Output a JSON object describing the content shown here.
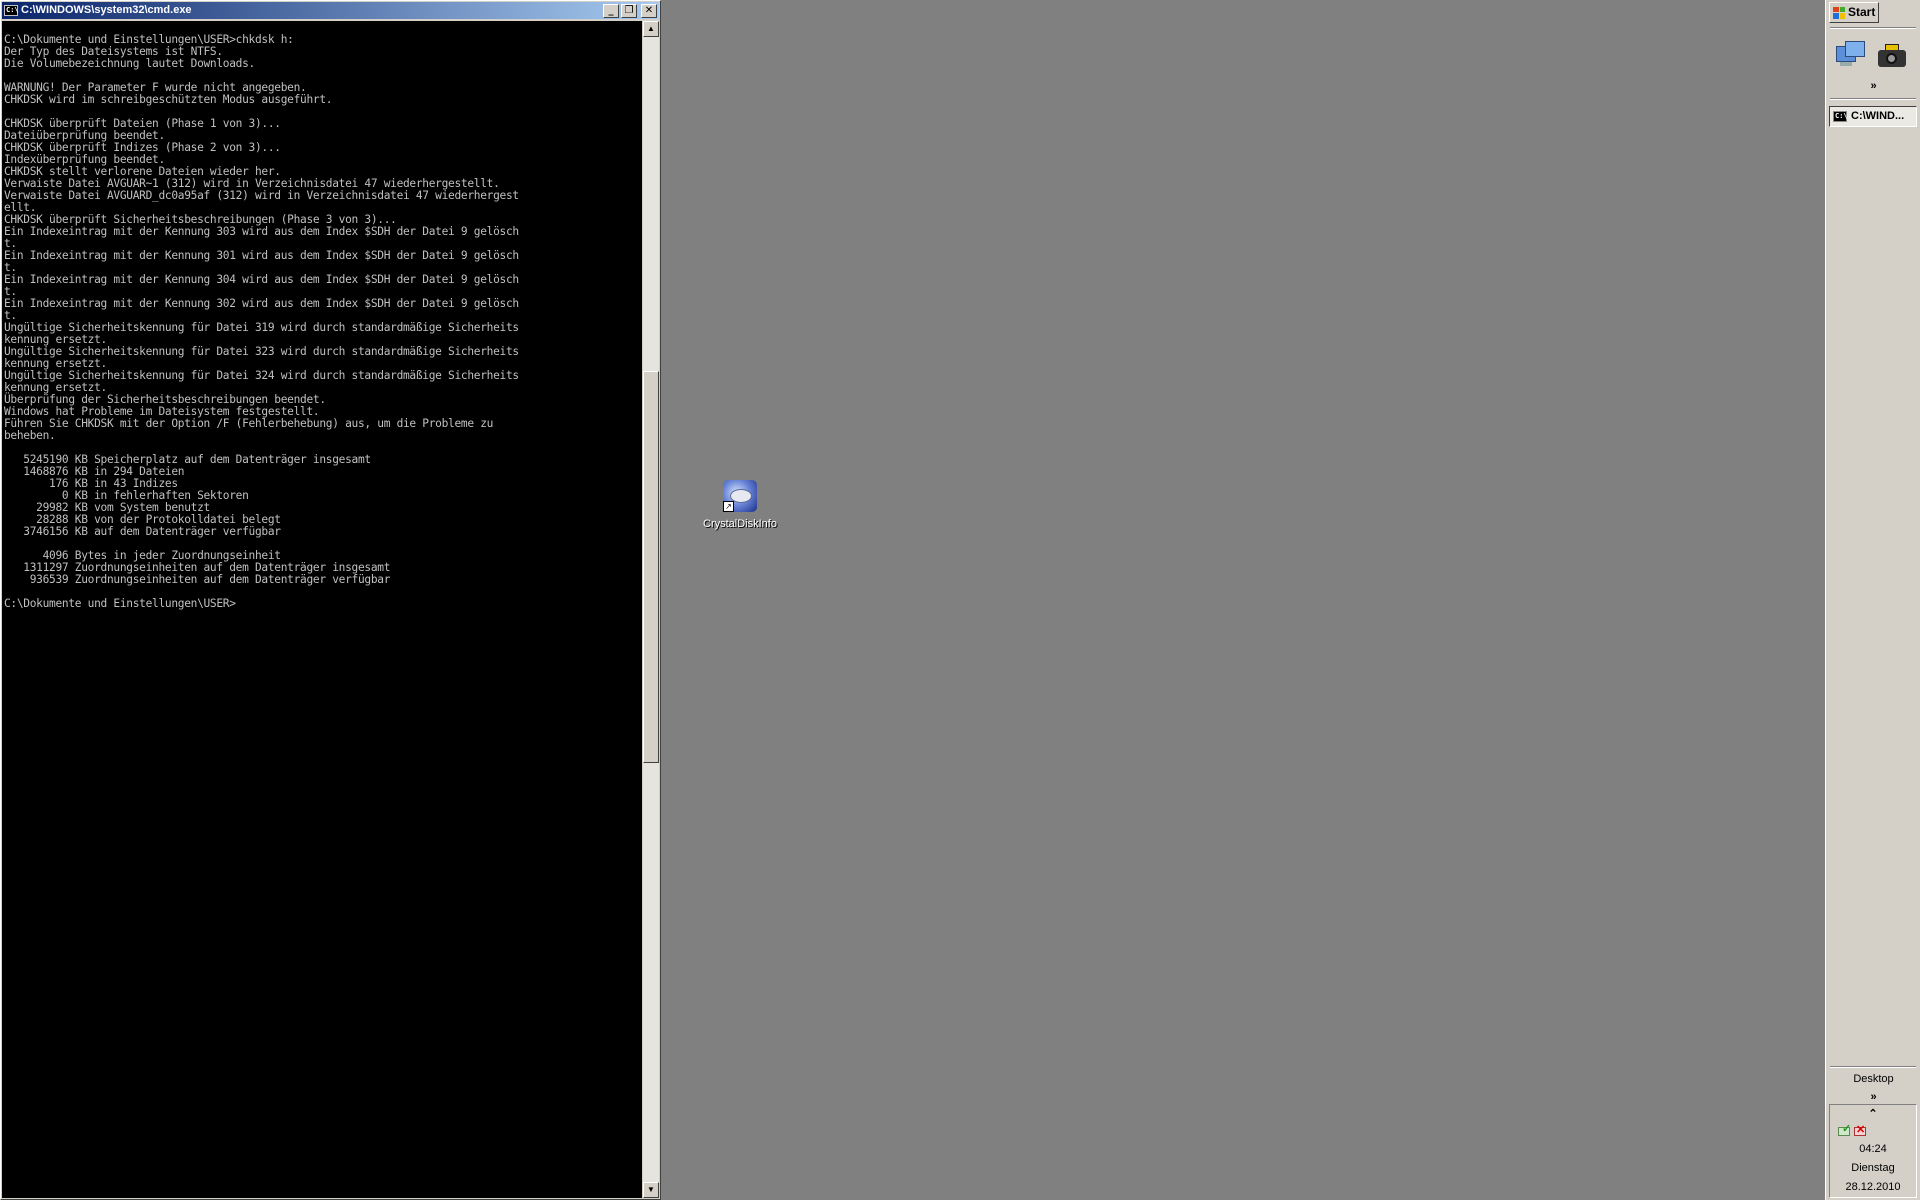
{
  "console_window": {
    "title": "C:\\WINDOWS\\system32\\cmd.exe",
    "app_icon_text": "C:\\",
    "buttons": {
      "minimize": "_",
      "restore": "❐",
      "close": "✕"
    },
    "output": "C:\\Dokumente und Einstellungen\\USER>chkdsk h:\nDer Typ des Dateisystems ist NTFS.\nDie Volumebezeichnung lautet Downloads.\n\nWARNUNG! Der Parameter F wurde nicht angegeben.\nCHKDSK wird im schreibgeschützten Modus ausgeführt.\n\nCHKDSK überprüft Dateien (Phase 1 von 3)...\nDateiüberprüfung beendet.\nCHKDSK überprüft Indizes (Phase 2 von 3)...\nIndexüberprüfung beendet.\nCHKDSK stellt verlorene Dateien wieder her.\nVerwaiste Datei AVGUAR~1 (312) wird in Verzeichnisdatei 47 wiederhergestellt.\nVerwaiste Datei AVGUARD_dc0a95af (312) wird in Verzeichnisdatei 47 wiederhergest\nellt.\nCHKDSK überprüft Sicherheitsbeschreibungen (Phase 3 von 3)...\nEin Indexeintrag mit der Kennung 303 wird aus dem Index $SDH der Datei 9 gelösch\nt.\nEin Indexeintrag mit der Kennung 301 wird aus dem Index $SDH der Datei 9 gelösch\nt.\nEin Indexeintrag mit der Kennung 304 wird aus dem Index $SDH der Datei 9 gelösch\nt.\nEin Indexeintrag mit der Kennung 302 wird aus dem Index $SDH der Datei 9 gelösch\nt.\nUngültige Sicherheitskennung für Datei 319 wird durch standardmäßige Sicherheits\nkennung ersetzt.\nUngültige Sicherheitskennung für Datei 323 wird durch standardmäßige Sicherheits\nkennung ersetzt.\nUngültige Sicherheitskennung für Datei 324 wird durch standardmäßige Sicherheits\nkennung ersetzt.\nÜberprüfung der Sicherheitsbeschreibungen beendet.\nWindows hat Probleme im Dateisystem festgestellt.\nFühren Sie CHKDSK mit der Option /F (Fehlerbehebung) aus, um die Probleme zu\nbeheben.\n\n   5245190 KB Speicherplatz auf dem Datenträger insgesamt\n   1468876 KB in 294 Dateien\n       176 KB in 43 Indizes\n         0 KB in fehlerhaften Sektoren\n     29982 KB vom System benutzt\n     28288 KB von der Protokolldatei belegt\n   3746156 KB auf dem Datenträger verfügbar\n\n      4096 Bytes in jeder Zuordnungseinheit\n   1311297 Zuordnungseinheiten auf dem Datenträger insgesamt\n    936539 Zuordnungseinheiten auf dem Datenträger verfügbar\n\nC:\\Dokumente und Einstellungen\\USER>"
  },
  "desktop": {
    "icons": [
      {
        "label": "CrystalDiskInfo"
      }
    ]
  },
  "taskbar": {
    "start_label": "Start",
    "quicklaunch_more": "»",
    "task_buttons": [
      {
        "label": "C:\\WIND...",
        "icon_text": "C:\\"
      }
    ],
    "desktop_toolbar_label": "Desktop",
    "desktop_toolbar_more": "»",
    "tray_expand": "⌃",
    "clock": {
      "time": "04:24",
      "day": "Dienstag",
      "date": "28.12.2010"
    }
  },
  "colors": {
    "desktop_bg": "#808080",
    "console_bg": "#000000",
    "console_text": "#c0c0c0",
    "titlebar_start": "#0a246a",
    "titlebar_end": "#a6caf0",
    "chrome": "#d4d0c8"
  },
  "scrollbar": {
    "position_fraction": 0.41
  }
}
